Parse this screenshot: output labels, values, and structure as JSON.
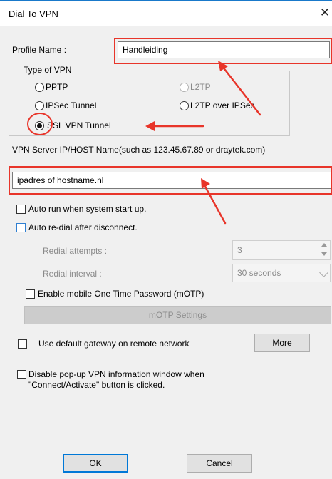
{
  "window": {
    "title": "Dial To VPN",
    "close_glyph": "✕"
  },
  "profile": {
    "label": "Profile Name :",
    "value": "Handleiding"
  },
  "vpn_type": {
    "legend": "Type of VPN",
    "options": {
      "pptp": "PPTP",
      "l2tp": "L2TP",
      "ipsec": "IPSec Tunnel",
      "l2tp_ipsec": "L2TP over IPSec",
      "ssl": "SSL VPN Tunnel"
    },
    "selected": "SSL VPN Tunnel"
  },
  "server": {
    "label": "VPN Server IP/HOST Name(such as 123.45.67.89 or draytek.com)",
    "value": "ipadres of hostname.nl"
  },
  "options": {
    "auto_run": "Auto run when system start up.",
    "auto_redial": "Auto re-dial after disconnect.",
    "redial_attempts_label": "Redial attempts :",
    "redial_attempts_value": "3",
    "redial_interval_label": "Redial interval :",
    "redial_interval_value": "30 seconds",
    "motp": "Enable mobile One Time Password (mOTP)",
    "motp_settings": "mOTP Settings",
    "default_gateway": "Use default gateway on remote network",
    "more": "More",
    "disable_popup_line1": "Disable pop-up VPN information window when",
    "disable_popup_line2": "\"Connect/Activate\" button is clicked."
  },
  "buttons": {
    "ok": "OK",
    "cancel": "Cancel"
  },
  "annotation_color": "#e8352a"
}
